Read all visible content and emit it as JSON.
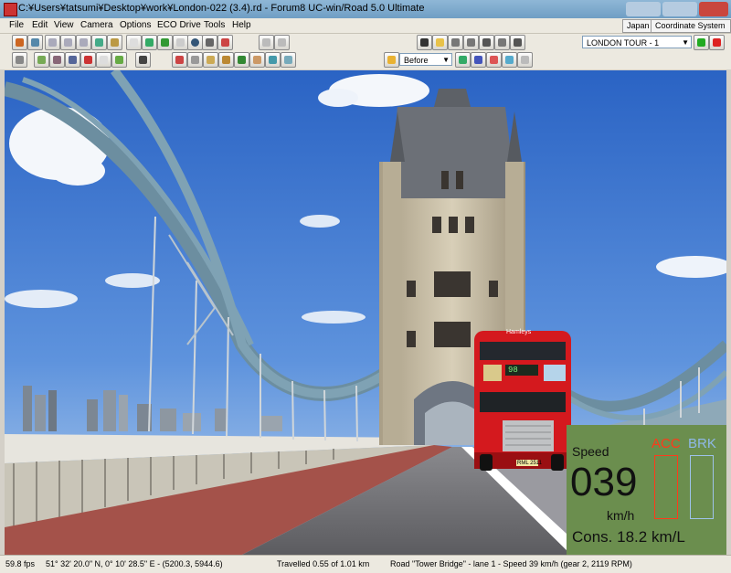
{
  "window": {
    "title": "C:¥Users¥tatsumi¥Desktop¥work¥London-022 (3.4).rd - Forum8 UC-win/Road 5.0 Ultimate"
  },
  "menu": [
    "File",
    "Edit",
    "View",
    "Camera",
    "Options",
    "ECO Drive",
    "Tools",
    "Help"
  ],
  "chips": {
    "region": "Japan",
    "coordinate": "Coordinate System 0"
  },
  "toolbar": {
    "tour_select": "LONDON TOUR - 1",
    "time_select": "Before"
  },
  "scene": {
    "bus_destination": "98",
    "bus_sign": "Hamleys",
    "bus_plate": "RML 2511"
  },
  "hud": {
    "speed_label": "Speed",
    "speed_value": "039",
    "speed_unit": "km/h",
    "acc_label": "ACC",
    "brk_label": "BRK",
    "consumption": "Cons. 18.2 km/L",
    "acc_level": 0,
    "brk_level": 0
  },
  "status": {
    "fps": "59.8 fps",
    "position": "51°  32' 20.0\" N, 0°  10' 28.5\" E  -  (5200.3, 5944.6)",
    "travelled": "Travelled 0.55 of 1.01 km",
    "road": "Road \"Tower Bridge\" - lane 1 - Speed 39 km/h (gear 2, 2119 RPM)"
  },
  "colors": {
    "sky_top": "#2a63c4",
    "acc": "#ff3a1a",
    "brk": "#8fb8e8",
    "hud_bg": "#6b8e4e",
    "bus_red": "#d4191e"
  }
}
